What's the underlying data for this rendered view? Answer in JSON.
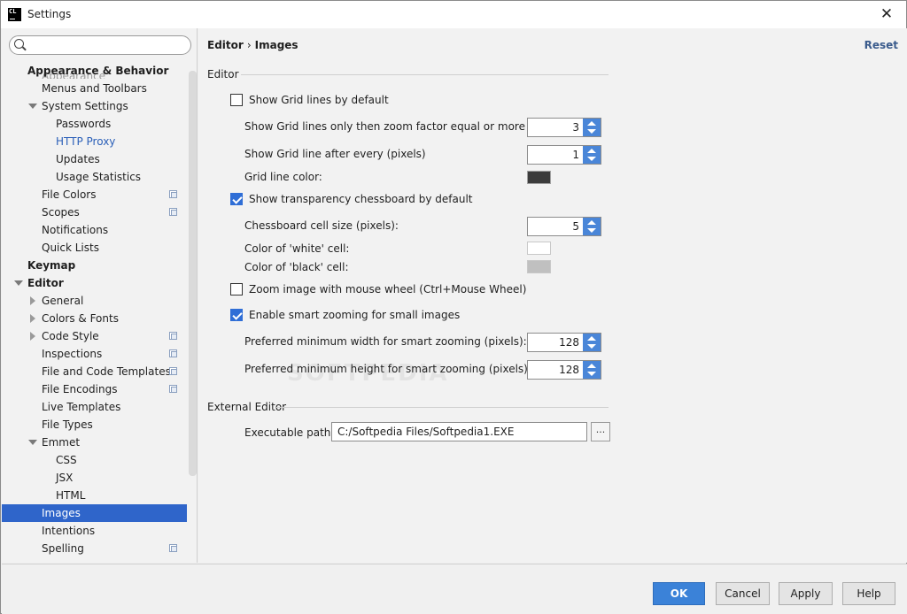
{
  "window": {
    "title": "Settings",
    "app_icon_text": "CL"
  },
  "search": {
    "placeholder": "",
    "value": ""
  },
  "sidebar": {
    "faded_item": "Appearance",
    "items": [
      {
        "label": "Appearance & Behavior",
        "level": 0,
        "bold": true
      },
      {
        "label": "Menus and Toolbars",
        "level": 1
      },
      {
        "label": "System Settings",
        "level": 1,
        "expanded": true
      },
      {
        "label": "Passwords",
        "level": 2
      },
      {
        "label": "HTTP Proxy",
        "level": 2,
        "link": true
      },
      {
        "label": "Updates",
        "level": 2
      },
      {
        "label": "Usage Statistics",
        "level": 2
      },
      {
        "label": "File Colors",
        "level": 1,
        "copy": true
      },
      {
        "label": "Scopes",
        "level": 1,
        "copy": true
      },
      {
        "label": "Notifications",
        "level": 1
      },
      {
        "label": "Quick Lists",
        "level": 1
      },
      {
        "label": "Keymap",
        "level": 0,
        "bold": true
      },
      {
        "label": "Editor",
        "level": 0,
        "bold": true,
        "expanded": true
      },
      {
        "label": "General",
        "level": 1,
        "collapsed": true
      },
      {
        "label": "Colors & Fonts",
        "level": 1,
        "collapsed": true
      },
      {
        "label": "Code Style",
        "level": 1,
        "collapsed": true,
        "copy": true
      },
      {
        "label": "Inspections",
        "level": 1,
        "copy": true
      },
      {
        "label": "File and Code Templates",
        "level": 1,
        "copy": true
      },
      {
        "label": "File Encodings",
        "level": 1,
        "copy": true
      },
      {
        "label": "Live Templates",
        "level": 1
      },
      {
        "label": "File Types",
        "level": 1
      },
      {
        "label": "Emmet",
        "level": 1,
        "expanded": true
      },
      {
        "label": "CSS",
        "level": 2
      },
      {
        "label": "JSX",
        "level": 2
      },
      {
        "label": "HTML",
        "level": 2
      },
      {
        "label": "Images",
        "level": 1,
        "selected": true
      },
      {
        "label": "Intentions",
        "level": 1
      },
      {
        "label": "Spelling",
        "level": 1,
        "copy": true
      }
    ]
  },
  "header": {
    "crumb_parent": "Editor",
    "crumb_sep": "›",
    "crumb_current": "Images",
    "reset_label": "Reset"
  },
  "editor_section": {
    "title": "Editor",
    "show_grid": {
      "label": "Show Grid lines by default",
      "checked": false
    },
    "grid_zoom": {
      "label": "Show Grid lines only then zoom factor equal or more than:",
      "value": "3"
    },
    "grid_every": {
      "label": "Show Grid line after every (pixels)",
      "value": "1"
    },
    "grid_color": {
      "label": "Grid line color:",
      "color": "#3c3c3c"
    },
    "show_chess": {
      "label": "Show transparency chessboard by default",
      "checked": true
    },
    "chess_size": {
      "label": "Chessboard cell size (pixels):",
      "value": "5"
    },
    "white_cell": {
      "label": "Color of 'white' cell:",
      "color": "#ffffff"
    },
    "black_cell": {
      "label": "Color of 'black' cell:",
      "color": "#c0c0c0"
    },
    "zoom_wheel": {
      "label": "Zoom image with mouse wheel (Ctrl+Mouse Wheel)",
      "checked": false
    },
    "smart_zoom": {
      "label": "Enable smart zooming for small images",
      "checked": true
    },
    "min_width": {
      "label": "Preferred minimum width for smart zooming (pixels):",
      "value": "128"
    },
    "min_height": {
      "label": "Preferred minimum height for smart zooming (pixels):",
      "value": "128"
    }
  },
  "external_section": {
    "title": "External Editor",
    "path_label": "Executable path:",
    "path_value": "C:/Softpedia Files/Softpedia1.EXE",
    "browse_label": "..."
  },
  "watermark": "SOFTPEDIA",
  "footer": {
    "ok": "OK",
    "cancel": "Cancel",
    "apply": "Apply",
    "help": "Help"
  },
  "colors": {
    "accent": "#2f65ca",
    "primary_button": "#3b82d8",
    "link": "#2a5fb8",
    "reset": "#3a5b8c"
  }
}
